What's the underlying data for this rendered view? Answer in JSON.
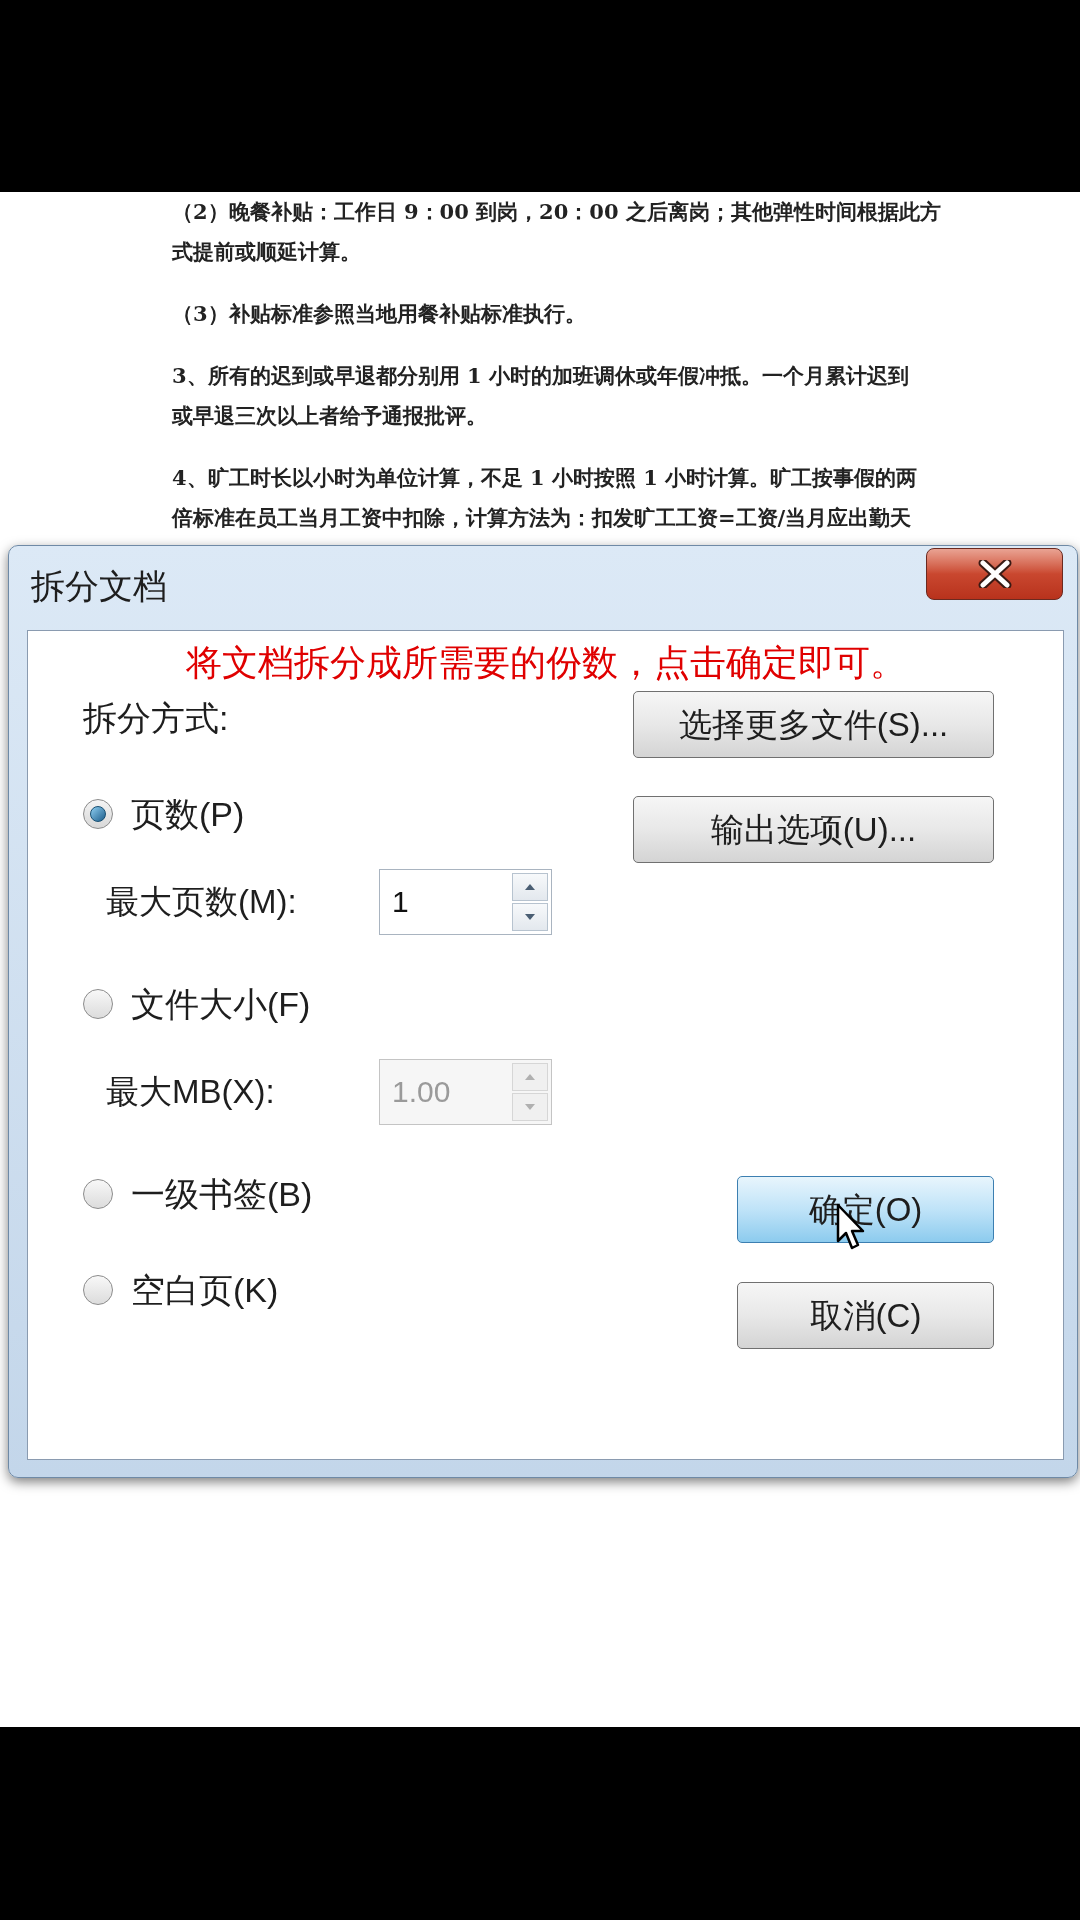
{
  "document": {
    "paragraphs": [
      {
        "lines": [
          "（2）晚餐补贴：工作日 9：00 到岗，20：00 之后离岗；其他弹性时间根据此方",
          "式提前或顺延计算。"
        ]
      },
      {
        "lines": [
          "（3）补贴标准参照当地用餐补贴标准执行。"
        ]
      },
      {
        "lines": [
          "3、所有的迟到或早退都分别用 1 小时的加班调休或年假冲抵。一个月累计迟到",
          "或早退三次以上者给予通报批评。"
        ]
      },
      {
        "lines": [
          "4、旷工时长以小时为单位计算，不足 1 小时按照 1 小时计算。旷工按事假的两",
          "倍标准在员工当月工资中扣除，计算方法为：扣发旷工工资=工资/当月应出勤天"
        ]
      }
    ]
  },
  "dialog": {
    "title": "拆分文档",
    "instruction": "将文档拆分成所需要的份数，点击确定即可。",
    "method_label": "拆分方式:",
    "options": [
      {
        "label": "页数(P)",
        "selected": true,
        "field": {
          "label": "最大页数(M):",
          "value": "1",
          "disabled": false
        }
      },
      {
        "label": "文件大小(F)",
        "selected": false,
        "field": {
          "label": "最大MB(X):",
          "value": "1.00",
          "disabled": true
        }
      },
      {
        "label": "一级书签(B)",
        "selected": false
      },
      {
        "label": "空白页(K)",
        "selected": false
      }
    ],
    "top_buttons": [
      {
        "label": "选择更多文件(S)...",
        "focused": false
      },
      {
        "label": "输出选项(U)...",
        "focused": false
      }
    ],
    "action_buttons": [
      {
        "label": "确定(O)",
        "focused": true
      },
      {
        "label": "取消(C)",
        "focused": false
      }
    ]
  }
}
